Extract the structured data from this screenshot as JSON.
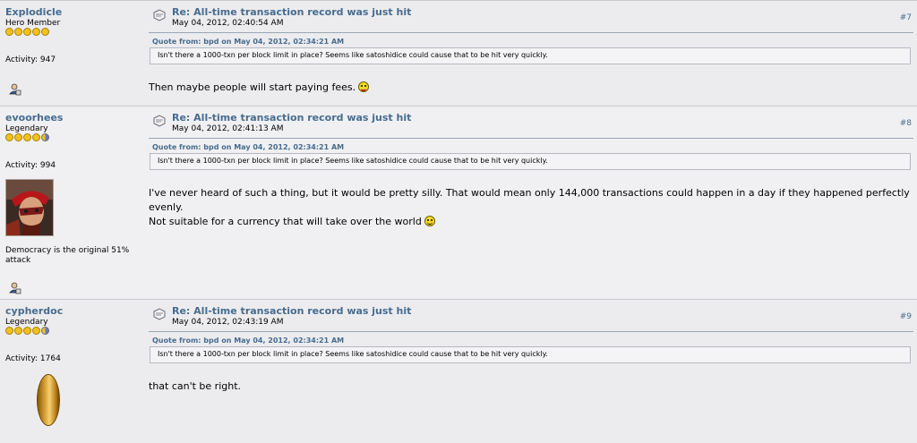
{
  "posts": [
    {
      "author": "Explodicle",
      "rank": "Hero Member",
      "stars": "5 of 5",
      "activity": "Activity: 947",
      "subject": "Re: All-time transaction record was just hit",
      "timestamp": "May 04, 2012, 02:40:54 AM",
      "number": "#7",
      "quote_header": "Quote from: bpd on May 04, 2012, 02:34:21 AM",
      "quote_text": "Isn't there a 1000-txn per block limit in place? Seems like satoshidice could cause that to be hit very quickly.",
      "body": "Then maybe people will start paying fees.",
      "smiley": "tongue"
    },
    {
      "author": "evoorhees",
      "rank": "Legendary",
      "stars": "4.5 of 5",
      "activity": "Activity: 994",
      "avatar": "masked-man-avatar",
      "signature": "Democracy is the original 51% attack",
      "subject": "Re: All-time transaction record was just hit",
      "timestamp": "May 04, 2012, 02:41:13 AM",
      "number": "#8",
      "quote_header": "Quote from: bpd on May 04, 2012, 02:34:21 AM",
      "quote_text": "Isn't there a 1000-txn per block limit in place? Seems like satoshidice could cause that to be hit very quickly.",
      "body_line1": "I've never heard of such a thing, but it would be pretty silly. That would mean only 144,000 transactions could happen in a day if they happened perfectly evenly.",
      "body_line2": "Not suitable for a currency that will take over the world",
      "smiley": "smile"
    },
    {
      "author": "cypherdoc",
      "rank": "Legendary",
      "stars": "4.5 of 5",
      "activity": "Activity: 1764",
      "avatar": "gold-coin-avatar",
      "subject": "Re: All-time transaction record was just hit",
      "timestamp": "May 04, 2012, 02:43:19 AM",
      "number": "#9",
      "quote_header": "Quote from: bpd on May 04, 2012, 02:34:21 AM",
      "quote_text": "Isn't there a 1000-txn per block limit in place? Seems like satoshidice could cause that to be hit very quickly.",
      "body": "that can't be right."
    }
  ],
  "icons": {
    "profile": "profile-icon",
    "post_header": "message-icon"
  },
  "colors": {
    "link": "#476c8e",
    "star": "#f2c21b",
    "background": "#ececef"
  }
}
